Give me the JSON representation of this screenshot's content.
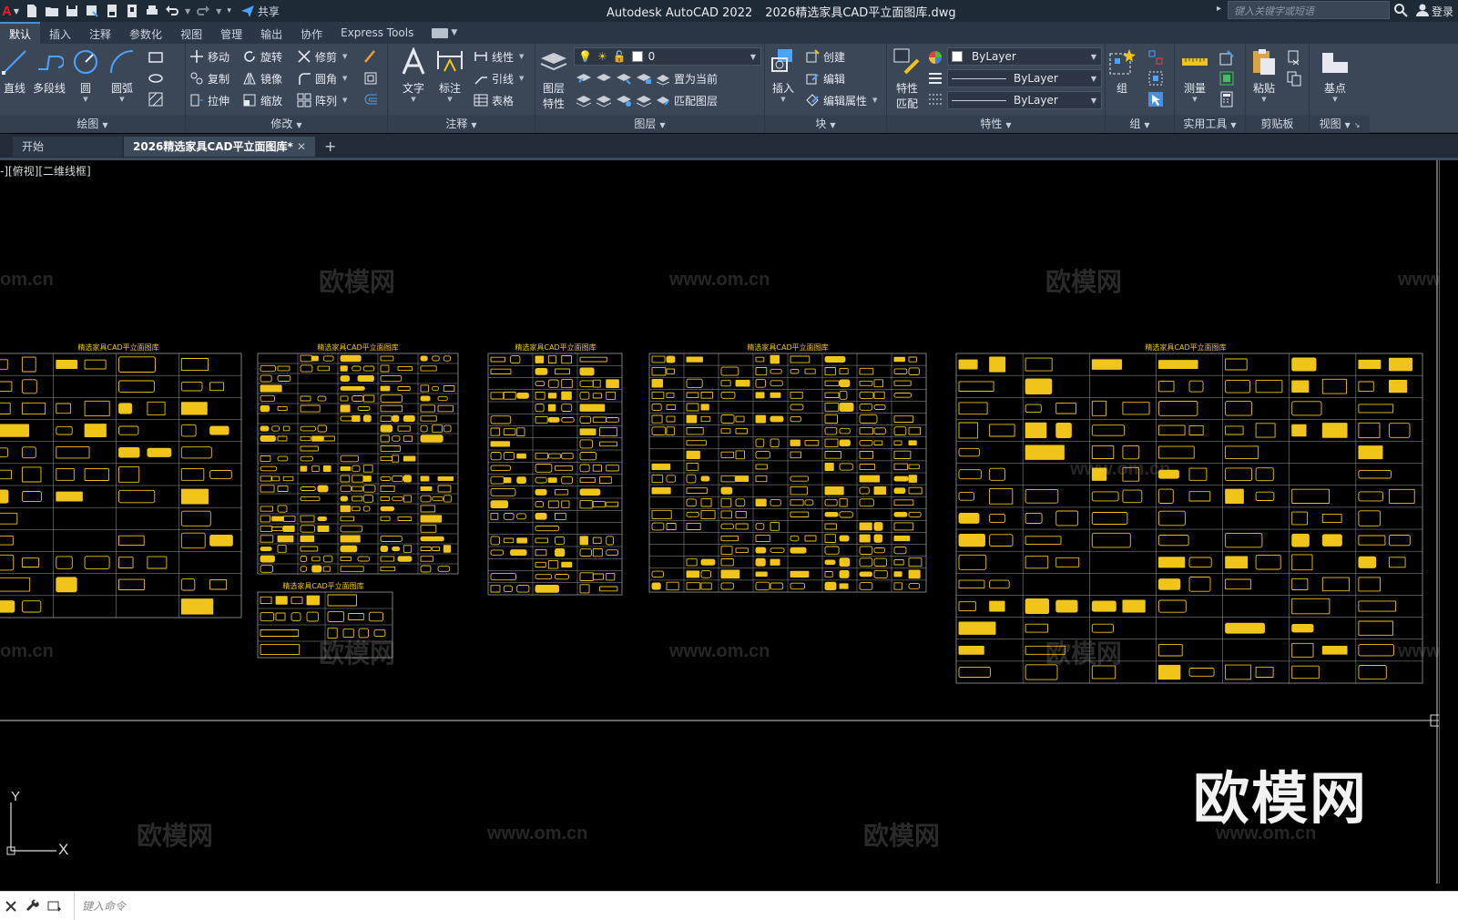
{
  "app": {
    "logo_letter": "A",
    "product": "Autodesk AutoCAD 2022",
    "filename": "2026精选家具CAD平立面图库.dwg",
    "share_label": "共享",
    "search_placeholder": "键入关键字或短语",
    "login_label": "登录"
  },
  "ribbon_tabs": [
    "默认",
    "插入",
    "注释",
    "参数化",
    "视图",
    "管理",
    "输出",
    "协作",
    "Express Tools"
  ],
  "active_tab": "默认",
  "ribbon": {
    "draw": {
      "title": "绘图",
      "line": "直线",
      "polyline": "多段线",
      "circle": "圆",
      "arc": "圆弧"
    },
    "modify": {
      "title": "修改",
      "move": "移动",
      "rotate": "旋转",
      "trim": "修剪",
      "copy": "复制",
      "mirror": "镜像",
      "fillet": "圆角",
      "stretch": "拉伸",
      "scale": "缩放",
      "array": "阵列"
    },
    "annotation": {
      "title": "注释",
      "text": "文字",
      "dimension": "标注",
      "linear": "线性",
      "leader": "引线",
      "table": "表格"
    },
    "layers": {
      "title": "图层",
      "layer_properties_1": "图层",
      "layer_properties_2": "特性",
      "current_layer": "0",
      "set_current": "置为当前",
      "match_layer": "匹配图层"
    },
    "block": {
      "title": "块",
      "insert": "插入",
      "create": "创建",
      "edit": "编辑",
      "edit_attributes": "编辑属性"
    },
    "properties": {
      "title": "特性",
      "match_1": "特性",
      "match_2": "匹配",
      "color": "ByLayer",
      "linetype": "ByLayer",
      "lineweight": "ByLayer"
    },
    "groups": {
      "title": "组",
      "group": "组"
    },
    "utilities": {
      "title": "实用工具",
      "measure": "测量"
    },
    "clipboard": {
      "title": "剪贴板",
      "paste": "粘贴"
    },
    "view": {
      "title": "视图",
      "base": "基点"
    }
  },
  "doc_tabs": {
    "start": "开始",
    "current": "2026精选家具CAD平立面图库*"
  },
  "viewport_label": "-][俯视][二维线框]",
  "drawing": {
    "sheet_title": "精选家具CAD平立面图库",
    "watermark_cn": "欧模网",
    "watermark_url": "www.om.cn",
    "watermark_url_partial": "om.cn",
    "watermark_url_partial_right": "www.o",
    "logo": "欧模网",
    "ucs_y": "Y",
    "ucs_x": "X"
  },
  "command": {
    "placeholder": "键入命令"
  },
  "colors": {
    "block_yellow": "#f0c419",
    "grid_gray": "#9a9a9a",
    "ribbon_bg": "#3b4757"
  }
}
